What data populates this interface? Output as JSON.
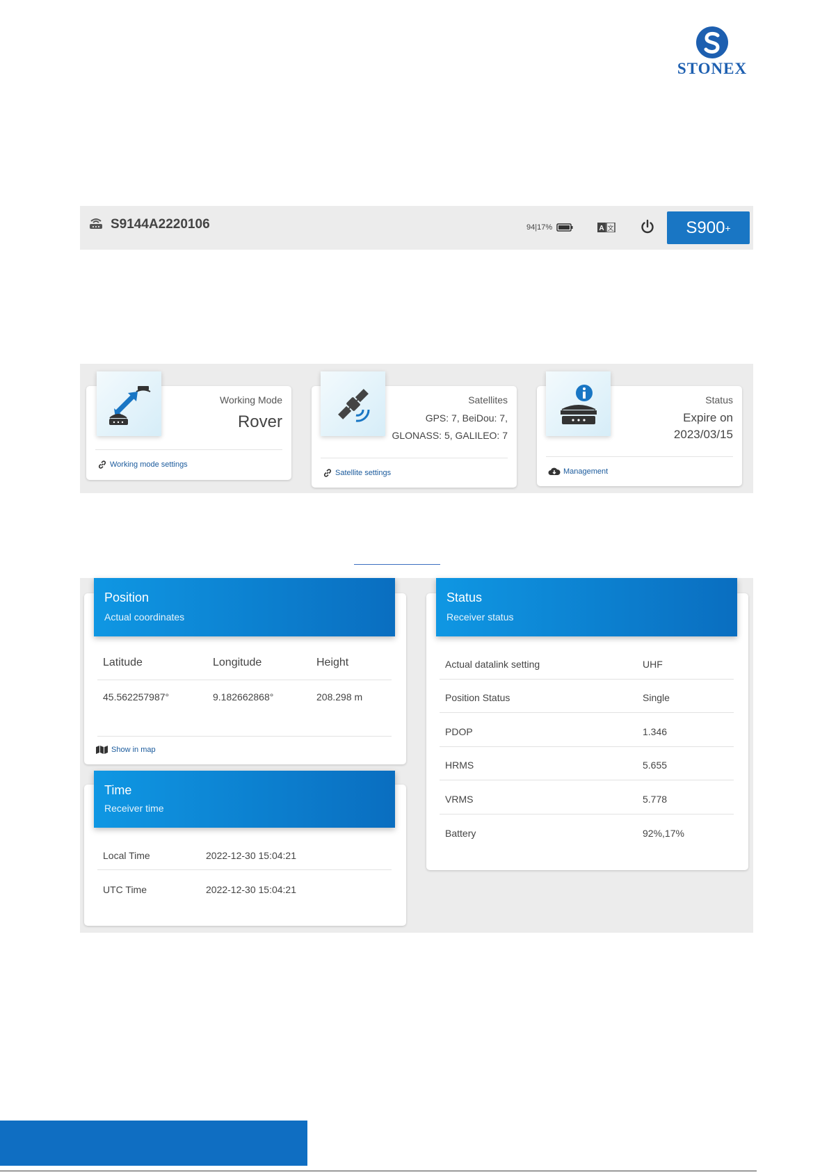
{
  "logo": {
    "text": "STONEX"
  },
  "topbar": {
    "device_id": "S9144A2220106",
    "battery_text": "94|17%",
    "model": "S900",
    "model_sup": "+"
  },
  "summary": {
    "working_mode": {
      "label": "Working Mode",
      "value": "Rover",
      "link": "Working mode settings"
    },
    "satellites": {
      "label": "Satellites",
      "line1": "GPS: 7, BeiDou: 7,",
      "line2": "GLONASS: 5, GALILEO: 7",
      "link": "Satellite settings"
    },
    "status": {
      "label": "Status",
      "line1": "Expire on",
      "line2": "2023/03/15",
      "link": "Management"
    }
  },
  "position": {
    "title": "Position",
    "subtitle": "Actual coordinates",
    "headers": [
      "Latitude",
      "Longitude",
      "Height"
    ],
    "values": [
      "45.562257987°",
      "9.182662868°",
      "208.298 m"
    ],
    "link": "Show in map"
  },
  "time": {
    "title": "Time",
    "subtitle": "Receiver time",
    "rows": [
      {
        "label": "Local Time",
        "value": "2022-12-30 15:04:21"
      },
      {
        "label": "UTC Time",
        "value": "2022-12-30 15:04:21"
      }
    ]
  },
  "status_panel": {
    "title": "Status",
    "subtitle": "Receiver status",
    "rows": [
      {
        "label": "Actual datalink setting",
        "value": "UHF"
      },
      {
        "label": "Position Status",
        "value": "Single"
      },
      {
        "label": "PDOP",
        "value": "1.346"
      },
      {
        "label": "HRMS",
        "value": "5.655"
      },
      {
        "label": "VRMS",
        "value": "5.778"
      },
      {
        "label": "Battery",
        "value": "92%,17%"
      }
    ]
  },
  "colors": {
    "accent": "#1976c4",
    "brand": "#1d5fb0",
    "link": "#1a5a9c"
  }
}
